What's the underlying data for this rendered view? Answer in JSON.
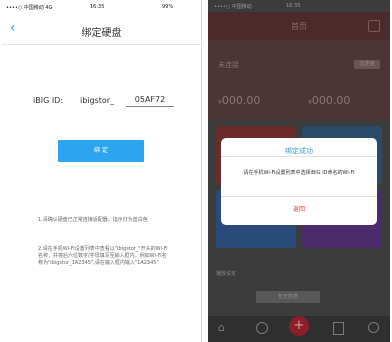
{
  "left": {
    "status": {
      "carrier": "••••○ 中国移动 4G",
      "time": "16:35",
      "battery": "99%"
    },
    "nav": {
      "back_glyph": "‹",
      "title": "绑定硬盘"
    },
    "id_field": {
      "label": "iBIG ID:",
      "prefix": "ibigstor_",
      "value": "05AF72"
    },
    "confirm_button": "绑 定",
    "instructions": [
      "1.请确认硬盘已正常连接适配器，指示灯为蓝白色",
      "2.请在手机Wi-Fi设置列表中查看以\"ibigstor_\"开头的Wi-Fi名称，并将后六位数字/字母填写至输入框内。例如Wi-Fi名称为\"ibigstor_1A2345\",请在输入框内输入\"1A2345\""
    ]
  },
  "right": {
    "status": {
      "carrier": "••••○ 中国移动",
      "time": "16:35"
    },
    "nav_title": "首页",
    "section": {
      "title": "未连接",
      "button": "去连接",
      "amount_left": "000.00",
      "amount_right": "000.00",
      "amount_prefix": "¥"
    },
    "bottom_label": "播放设定",
    "bottom_pill": "暂无数据",
    "dialog": {
      "title": "绑定成功",
      "message": "请在手机Wi-Fi设置列表中选择iBIG ID命名的Wi-Fi",
      "button": "返回"
    }
  }
}
